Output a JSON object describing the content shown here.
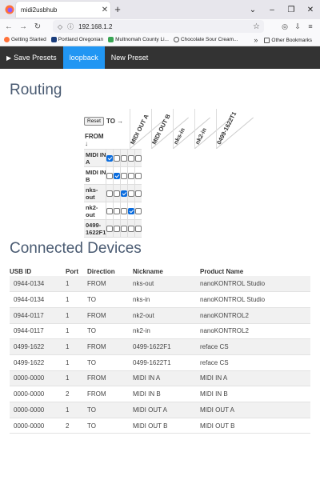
{
  "browser": {
    "tab_title": "midi2usbhub",
    "url": "192.168.1.2",
    "bookmarks": [
      "Getting Started",
      "Portland Oregonian",
      "Multnomah County Li...",
      "Chocolate Sour Cream..."
    ],
    "other_bookmarks": "Other Bookmarks"
  },
  "nav": {
    "save_presets": "Save Presets",
    "loopback": "loopback",
    "new_preset": "New Preset"
  },
  "routing": {
    "title": "Routing",
    "reset_label": "Reset",
    "to_label": "TO →",
    "from_label": "FROM ↓",
    "columns": [
      "MIDI OUT A",
      "MIDI OUT B",
      "nks-in",
      "nk2-in",
      "0499-1622T1"
    ],
    "rows": [
      {
        "label": "MIDI IN A",
        "checks": [
          true,
          false,
          false,
          false,
          false
        ]
      },
      {
        "label": "MIDI IN B",
        "checks": [
          false,
          true,
          false,
          false,
          false
        ]
      },
      {
        "label": "nks-out",
        "checks": [
          false,
          false,
          true,
          false,
          false
        ]
      },
      {
        "label": "nk2-out",
        "checks": [
          false,
          false,
          false,
          true,
          false
        ]
      },
      {
        "label": "0499-1622F1",
        "checks": [
          false,
          false,
          false,
          false,
          false
        ]
      }
    ]
  },
  "devices": {
    "title": "Connected Devices",
    "headers": [
      "USB ID",
      "Port",
      "Direction",
      "Nickname",
      "Product Name"
    ],
    "rows": [
      [
        "0944-0134",
        "1",
        "FROM",
        "nks-out",
        "nanoKONTROL Studio"
      ],
      [
        "0944-0134",
        "1",
        "TO",
        "nks-in",
        "nanoKONTROL Studio"
      ],
      [
        "0944-0117",
        "1",
        "FROM",
        "nk2-out",
        "nanoKONTROL2"
      ],
      [
        "0944-0117",
        "1",
        "TO",
        "nk2-in",
        "nanoKONTROL2"
      ],
      [
        "0499-1622",
        "1",
        "FROM",
        "0499-1622F1",
        "reface CS"
      ],
      [
        "0499-1622",
        "1",
        "TO",
        "0499-1622T1",
        "reface CS"
      ],
      [
        "0000-0000",
        "1",
        "FROM",
        "MIDI IN A",
        "MIDI IN A"
      ],
      [
        "0000-0000",
        "2",
        "FROM",
        "MIDI IN B",
        "MIDI IN B"
      ],
      [
        "0000-0000",
        "1",
        "TO",
        "MIDI OUT A",
        "MIDI OUT A"
      ],
      [
        "0000-0000",
        "2",
        "TO",
        "MIDI OUT B",
        "MIDI OUT B"
      ]
    ]
  },
  "colors": {
    "nav_bg": "#333333",
    "nav_active": "#2196f3",
    "heading": "#4a5b72",
    "checkbox_on": "#0a6cde"
  }
}
